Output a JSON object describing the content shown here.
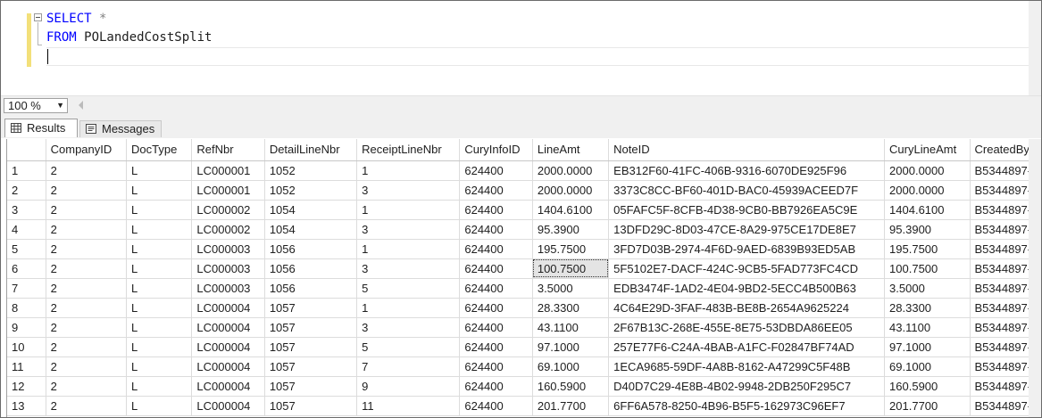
{
  "editor": {
    "line1_kw": "SELECT",
    "line1_rest": " *",
    "line2_kw": "FROM",
    "line2_table": " POLandedCostSplit"
  },
  "zoom": {
    "value": "100 %"
  },
  "tabs": {
    "results": "Results",
    "messages": "Messages"
  },
  "grid": {
    "columns": [
      "CompanyID",
      "DocType",
      "RefNbr",
      "DetailLineNbr",
      "ReceiptLineNbr",
      "CuryInfoID",
      "LineAmt",
      "NoteID",
      "CuryLineAmt",
      "CreatedByID"
    ],
    "rows": [
      [
        "1",
        "2",
        "L",
        "LC000001",
        "1052",
        "1",
        "624400",
        "2000.0000",
        "EB312F60-41FC-406B-9316-6070DE925F96",
        "2000.0000",
        "B5344897-"
      ],
      [
        "2",
        "2",
        "L",
        "LC000001",
        "1052",
        "3",
        "624400",
        "2000.0000",
        "3373C8CC-BF60-401D-BAC0-45939ACEED7F",
        "2000.0000",
        "B5344897-"
      ],
      [
        "3",
        "2",
        "L",
        "LC000002",
        "1054",
        "1",
        "624400",
        "1404.6100",
        "05FAFC5F-8CFB-4D38-9CB0-BB7926EA5C9E",
        "1404.6100",
        "B5344897-"
      ],
      [
        "4",
        "2",
        "L",
        "LC000002",
        "1054",
        "3",
        "624400",
        "95.3900",
        "13DFD29C-8D03-47CE-8A29-975CE17DE8E7",
        "95.3900",
        "B5344897-"
      ],
      [
        "5",
        "2",
        "L",
        "LC000003",
        "1056",
        "1",
        "624400",
        "195.7500",
        "3FD7D03B-2974-4F6D-9AED-6839B93ED5AB",
        "195.7500",
        "B5344897-"
      ],
      [
        "6",
        "2",
        "L",
        "LC000003",
        "1056",
        "3",
        "624400",
        "100.7500",
        "5F5102E7-DACF-424C-9CB5-5FAD773FC4CD",
        "100.7500",
        "B5344897-"
      ],
      [
        "7",
        "2",
        "L",
        "LC000003",
        "1056",
        "5",
        "624400",
        "3.5000",
        "EDB3474F-1AD2-4E04-9BD2-5ECC4B500B63",
        "3.5000",
        "B5344897-"
      ],
      [
        "8",
        "2",
        "L",
        "LC000004",
        "1057",
        "1",
        "624400",
        "28.3300",
        "4C64E29D-3FAF-483B-BE8B-2654A9625224",
        "28.3300",
        "B5344897-"
      ],
      [
        "9",
        "2",
        "L",
        "LC000004",
        "1057",
        "3",
        "624400",
        "43.1100",
        "2F67B13C-268E-455E-8E75-53DBDA86EE05",
        "43.1100",
        "B5344897-"
      ],
      [
        "10",
        "2",
        "L",
        "LC000004",
        "1057",
        "5",
        "624400",
        "97.1000",
        "257E77F6-C24A-4BAB-A1FC-F02847BF74AD",
        "97.1000",
        "B5344897-"
      ],
      [
        "11",
        "2",
        "L",
        "LC000004",
        "1057",
        "7",
        "624400",
        "69.1000",
        "1ECA9685-59DF-4A8B-8162-A47299C5F48B",
        "69.1000",
        "B5344897-"
      ],
      [
        "12",
        "2",
        "L",
        "LC000004",
        "1057",
        "9",
        "624400",
        "160.5900",
        "D40D7C29-4E8B-4B02-9948-2DB250F295C7",
        "160.5900",
        "B5344897-"
      ],
      [
        "13",
        "2",
        "L",
        "LC000004",
        "1057",
        "11",
        "624400",
        "201.7700",
        "6FF6A578-8250-4B96-B5F5-162973C96EF7",
        "201.7700",
        "B5344897-"
      ]
    ]
  }
}
